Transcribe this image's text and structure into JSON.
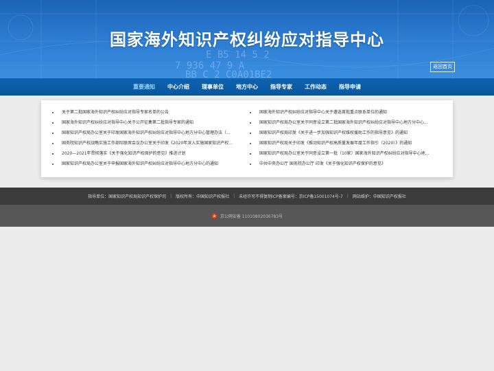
{
  "header": {
    "title": "国家海外知识产权纠纷应对指导中心",
    "back_home": "返回首页",
    "bg_digits": [
      "7 936 47 9 A",
      "BB C 2 C0A01BE2",
      "E B5 14 5 2"
    ]
  },
  "nav": {
    "items": [
      {
        "label": "重要通知",
        "active": true
      },
      {
        "label": "中心介绍",
        "active": false
      },
      {
        "label": "理事单位",
        "active": false
      },
      {
        "label": "地方中心",
        "active": false
      },
      {
        "label": "指导专家",
        "active": false
      },
      {
        "label": "工作动态",
        "active": false
      },
      {
        "label": "指导申请",
        "active": false
      }
    ]
  },
  "notices": {
    "left": [
      "关于第二批国家海外知识产权纠纷应对指导专家名单的公告",
      "国家海外知识产权纠纷应对指导中心关于公开征集第二批指导专家的通知",
      "国家知识产权局办公室关于印发国家海外知识产权纠纷应对指导中心地方分中心管理办法（...",
      "国务院知识产权战略实施工作部际联席会议办公室关于印发《2020年深入实施国家知识产权...",
      "2020—2021年贯彻落实《关于强化知识产权保护的意见》推进计划",
      "国家知识产权局办公室关于申报国家海外知识产权纠纷应对指导中心地方分中心的通知"
    ],
    "right": [
      "国家海外知识产权纠纷应对指导中心关于遴选首批重点联系单位的通知",
      "国家知识产权局办公室关于同意设立第二批国家海外知识产权纠纷应对指导中心地方分中心...",
      "国家知识产权局印发《关于进一步加强知识产权维权援助工作的指导意见》的通知",
      "国家知识产权局关于印发《推动知识产权高质量发展年度工作指引（2020）》的通知",
      "国家知识产权局办公室关于同意设立第一批（10家）国家海外知识产权纠纷应对指导中心地...",
      "中共中央办公厅 国务院办公厅 印发《关于强化知识产权保护的意见》"
    ]
  },
  "footer": {
    "guide_unit": "指导单位：国家知识产权局知识产权保护司",
    "copyright": "版权所有：中国知识产权报社",
    "notice": "未经许可不得复制ICP备案编号：京ICP备15001074号-7",
    "maintainer": "网站维护：中国知识产权报社",
    "police": "京公网安备 11010802036783号"
  },
  "colors": {
    "banner": "#2a7ad0",
    "nav": "#0d63b1",
    "nav_active": "#8fd3ff",
    "footer_top": "#3b3b3b",
    "footer_bottom": "#575757"
  }
}
